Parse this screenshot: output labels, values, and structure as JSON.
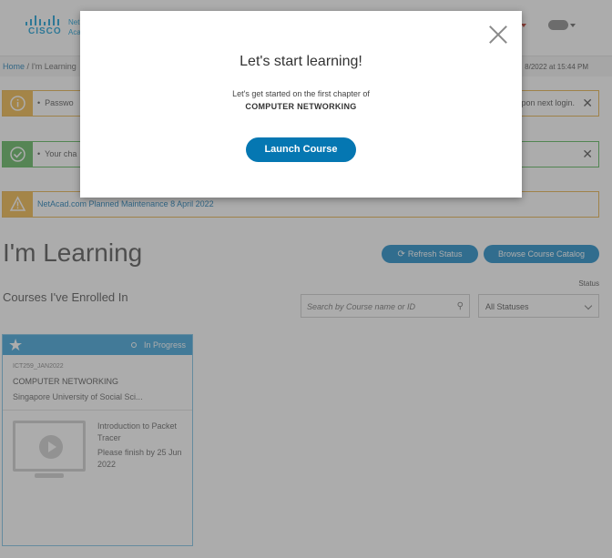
{
  "header": {
    "logo_word": "CISCO",
    "logo_sub_1": "Net",
    "logo_sub_2": "Aca"
  },
  "breadcrumb": {
    "home": "Home",
    "separator": "/",
    "current": "I'm Learning"
  },
  "last_login": "8/2022 at 15:44 PM",
  "alerts": [
    {
      "type": "warning",
      "icon": "info-icon",
      "message": "Passwo",
      "message_right": "pon next login."
    },
    {
      "type": "success",
      "icon": "check-circle-icon",
      "message": "Your cha"
    },
    {
      "type": "maintenance",
      "icon": "warning-triangle-icon",
      "message": "NetAcad.com Planned Maintenance 8 April 2022"
    }
  ],
  "page": {
    "title": "I'm Learning",
    "refresh_label": "Refresh Status",
    "browse_label": "Browse Course Catalog",
    "section_title": "Courses I've Enrolled In",
    "status_label": "Status",
    "search_placeholder": "Search by Course name or ID",
    "status_value": "All Statuses"
  },
  "course": {
    "status": "In Progress",
    "code": "ICT259_JAN2022",
    "name": "COMPUTER NETWORKING",
    "org": "Singapore University of Social Sci...",
    "chapter_title": "Introduction to Packet Tracer",
    "due": "Please finish by 25 Jun 2022"
  },
  "modal": {
    "title": "Let's start learning!",
    "text": "Let's get started on the first chapter of",
    "course_name": "COMPUTER NETWORKING",
    "launch_label": "Launch Course"
  },
  "colors": {
    "accent": "#1f8dc9",
    "launch_button": "#0577b2",
    "warning": "#f1b84a",
    "success": "#63b862",
    "card_header": "#3ea5db"
  }
}
